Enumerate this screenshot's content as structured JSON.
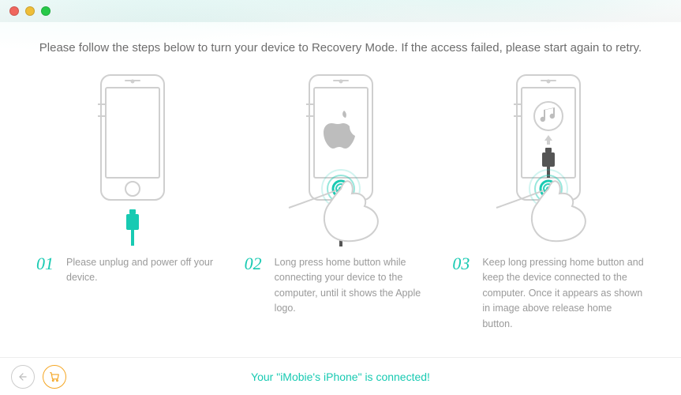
{
  "header": {
    "instruction": "Please follow the steps below to turn your device to Recovery Mode. If the access failed, please start again to retry."
  },
  "steps": [
    {
      "num": "01",
      "text": "Please unplug and power off your device."
    },
    {
      "num": "02",
      "text": "Long press home button while connecting your device to the computer, until it shows the Apple logo."
    },
    {
      "num": "03",
      "text": "Keep long pressing home button and keep the device connected to the computer. Once it appears as shown in image above release home button."
    }
  ],
  "footer": {
    "status": "Your \"iMobie's iPhone\" is connected!"
  },
  "colors": {
    "accent": "#18CAB2",
    "orange": "#f5a623"
  }
}
